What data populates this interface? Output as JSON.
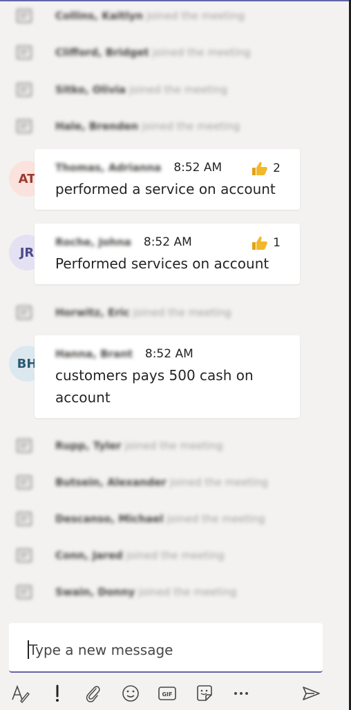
{
  "events": [
    {
      "name": "Collins, Kaitlyn",
      "text": "joined the meeting"
    },
    {
      "name": "Clifford, Bridget",
      "text": "joined the meeting"
    },
    {
      "name": "Sitko, Olivia",
      "text": "joined the meeting"
    },
    {
      "name": "Hale, Brenden",
      "text": "joined the meeting"
    },
    {
      "name": "Horwitz, Eric",
      "text": "joined the meeting"
    },
    {
      "name": "Rupp, Tyler",
      "text": "joined the meeting"
    },
    {
      "name": "Butsein, Alexander",
      "text": "joined the meeting"
    },
    {
      "name": "Descanso, Michael",
      "text": "joined the meeting"
    },
    {
      "name": "Conn, Jared",
      "text": "joined the meeting"
    },
    {
      "name": "Swain, Donny",
      "text": "joined the meeting"
    }
  ],
  "messages": [
    {
      "initials": "AT",
      "sender": "Thomas, Adrianna",
      "time": "8:52 AM",
      "reaction_count": "2",
      "text": "performed a service on account",
      "avatar_bg": "#fbe2dc",
      "avatar_fg": "#9a3b30"
    },
    {
      "initials": "JR",
      "sender": "Roche, Johna",
      "time": "8:52 AM",
      "reaction_count": "1",
      "text": "Performed services on account",
      "avatar_bg": "#e4e2f2",
      "avatar_fg": "#4f4a8c"
    },
    {
      "initials": "BH",
      "sender": "Hanna, Brant",
      "time": "8:52 AM",
      "text": "customers pays 500 cash on account",
      "avatar_bg": "#dce8ef",
      "avatar_fg": "#2b5a73"
    }
  ],
  "compose": {
    "placeholder": "Type a new message"
  },
  "toolbar": {
    "icons": [
      "format-icon",
      "important-icon",
      "attach-icon",
      "emoji-icon",
      "gif-icon",
      "sticker-icon",
      "more-options-icon",
      "send-icon"
    ],
    "gif_label": "GIF"
  },
  "colors": {
    "accent": "#6264a7",
    "background": "#f3f2f1",
    "status_busy": "#c4314b",
    "reaction": "#f2b827"
  }
}
